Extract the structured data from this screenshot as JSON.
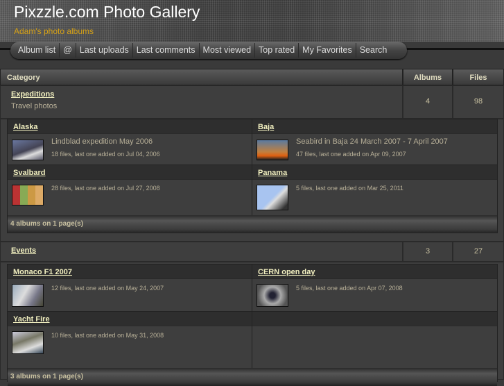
{
  "header": {
    "title": "Pixzzle.com Photo Gallery",
    "subtitle": "Adam's photo albums"
  },
  "nav": [
    "Album list",
    "@",
    "Last uploads",
    "Last comments",
    "Most viewed",
    "Top rated",
    "My Favorites",
    "Search"
  ],
  "table": {
    "headers": {
      "category": "Category",
      "albums": "Albums",
      "files": "Files"
    }
  },
  "categories": [
    {
      "name": "Expeditions",
      "desc": "Travel photos",
      "albums": "4",
      "files": "98",
      "items": [
        {
          "title": "Alaska",
          "name": "Lindblad expedition May 2006",
          "info": "18 files, last one added on Jul 04, 2006"
        },
        {
          "title": "Baja",
          "name": "Seabird in Baja 24 March 2007 - 7 April 2007",
          "info": "47 files, last one added on Apr 09, 2007"
        },
        {
          "title": "Svalbard",
          "name": "",
          "info": "28 files, last one added on Jul 27, 2008"
        },
        {
          "title": "Panama",
          "name": "",
          "info": "5 files, last one added on Mar 25, 2011"
        }
      ],
      "footer": "4 albums on 1 page(s)"
    },
    {
      "name": "Events",
      "desc": "",
      "albums": "3",
      "files": "27",
      "items": [
        {
          "title": "Monaco F1 2007",
          "info": "12 files, last one added on May 24, 2007"
        },
        {
          "title": "CERN open day",
          "info": "5 files, last one added on Apr 07, 2008"
        },
        {
          "title": "Yacht Fire",
          "info": "10 files, last one added on May 31, 2008"
        }
      ],
      "footer": "3 albums on 1 page(s)"
    }
  ]
}
